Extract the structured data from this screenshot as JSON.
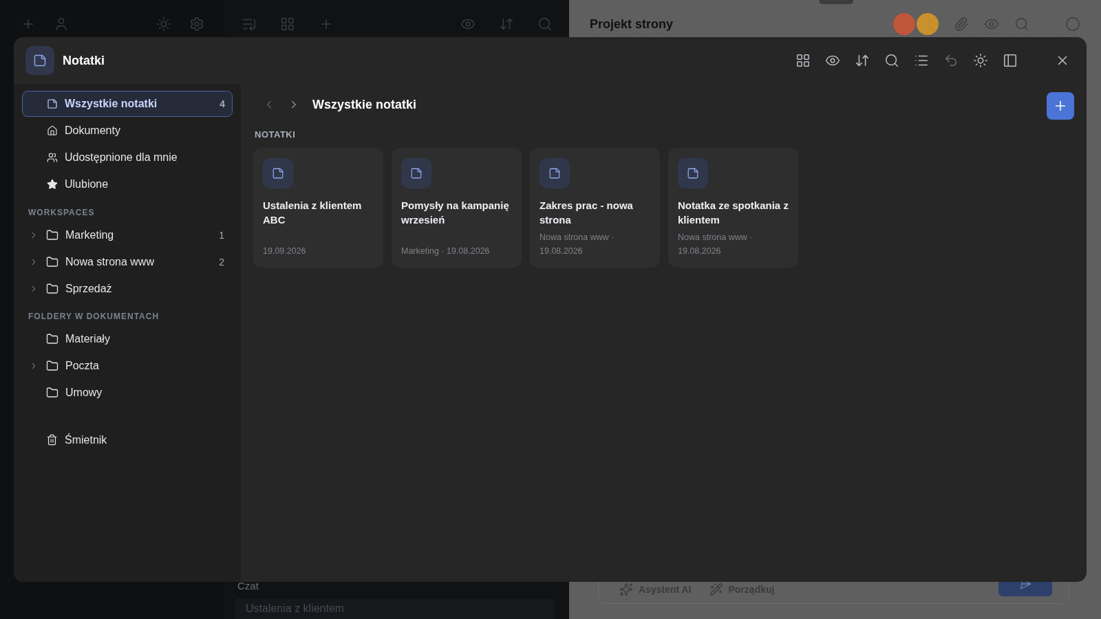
{
  "background": {
    "right_title": "Projekt strony",
    "avatars": [
      {
        "color": "#c0553a"
      },
      {
        "color": "#c9902e"
      }
    ],
    "chat": {
      "label": "Czat",
      "field": "Ustalenia z klientem"
    },
    "composer_actions": [
      {
        "kind": "ai",
        "label": "Asystent AI"
      },
      {
        "kind": "tidy",
        "label": "Porządkuj"
      }
    ]
  },
  "dialog": {
    "title": "Notatki",
    "nav": [
      {
        "kind": "notes",
        "label": "Wszystkie notatki",
        "count": "4",
        "selected": true
      },
      {
        "kind": "home",
        "label": "Dokumenty",
        "selected": false
      },
      {
        "kind": "people",
        "label": "Udostępnione dla mnie",
        "selected": false
      },
      {
        "kind": "star",
        "label": "Ulubione",
        "selected": false
      }
    ],
    "sections": [
      {
        "heading": "WORKSPACES",
        "items": [
          {
            "label": "Marketing",
            "count": "1",
            "expandable": true
          },
          {
            "label": "Nowa strona www",
            "count": "2",
            "expandable": true
          },
          {
            "label": "Sprzedaż",
            "expandable": true
          }
        ]
      },
      {
        "heading": "FOLDERY W DOKUMENTACH",
        "items": [
          {
            "label": "Materiały",
            "expandable": false
          },
          {
            "label": "Poczta",
            "expandable": true
          },
          {
            "label": "Umowy",
            "expandable": false
          }
        ]
      }
    ],
    "trash": "Śmietnik",
    "breadcrumb": "Wszystkie notatki",
    "section_label": "NOTATKI",
    "notes": [
      {
        "title": "Ustalenia z klientem ABC",
        "meta": "19.09.2026"
      },
      {
        "title": "Pomysły na kampanię wrzesień",
        "meta": "Marketing · 19.08.2026"
      },
      {
        "title": "Zakres prac - nowa strona",
        "meta": "Nowa strona www · 19.08.2026"
      },
      {
        "title": "Notatka ze spotkania z klientem",
        "meta": "Nowa strona www · 19.08.2026"
      }
    ]
  }
}
